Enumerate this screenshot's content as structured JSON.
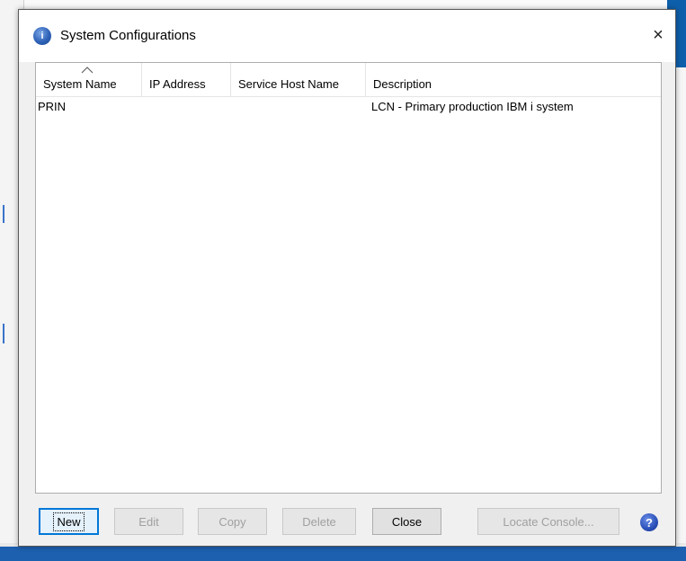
{
  "dialog": {
    "title": "System Configurations",
    "close_glyph": "×"
  },
  "table": {
    "columns": [
      "System Name",
      "IP Address",
      "Service Host Name",
      "Description"
    ],
    "sort_indicator": "^",
    "rows": [
      {
        "system_name": "PRIN",
        "ip_address": "",
        "service_host_name": "",
        "description": "LCN - Primary production IBM i system"
      }
    ]
  },
  "buttons": {
    "new": "New",
    "edit": "Edit",
    "copy": "Copy",
    "delete": "Delete",
    "close": "Close",
    "locate_console": "Locate Console...",
    "help_glyph": "?"
  },
  "icons": {
    "title": "info-icon",
    "help": "help-icon"
  },
  "colors": {
    "accent": "#0078d7",
    "dialog_bg": "#f0f0f0",
    "disabled_text": "#a0a0a0"
  }
}
